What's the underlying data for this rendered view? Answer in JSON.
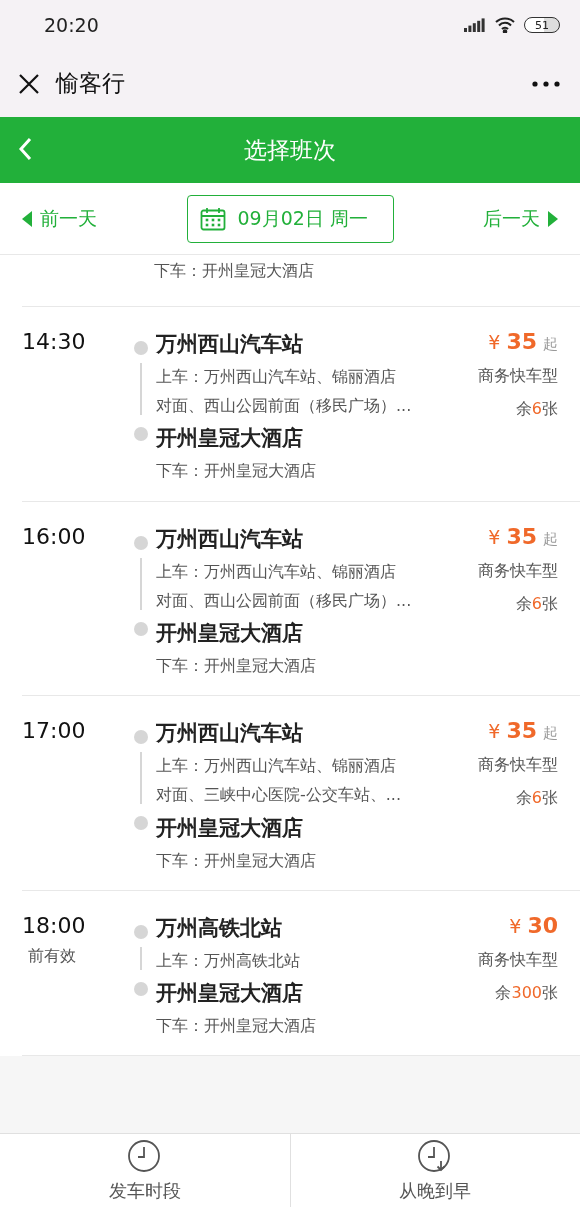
{
  "status_bar": {
    "time": "20:20",
    "battery": "51"
  },
  "app_bar": {
    "title": "愉客行"
  },
  "header": {
    "title": "选择班次"
  },
  "date_bar": {
    "prev": "前一天",
    "date": "09月02日 周一",
    "next": "后一天"
  },
  "partial_trip": {
    "dropoff": "下车：开州皇冠大酒店"
  },
  "trips": [
    {
      "time": "14:30",
      "from": "万州西山汽车站",
      "pickup_lines": [
        "上车：万州西山汽车站、锦丽酒店",
        "对面、西山公园前面（移民广场）..."
      ],
      "to": "开州皇冠大酒店",
      "dropoff": "下车：开州皇冠大酒店",
      "currency": "¥",
      "price": "35",
      "price_suffix": "起",
      "vehicle": "商务快车型",
      "seats": {
        "prefix": "余",
        "count": "6",
        "suffix": "张"
      }
    },
    {
      "time": "16:00",
      "from": "万州西山汽车站",
      "pickup_lines": [
        "上车：万州西山汽车站、锦丽酒店",
        "对面、西山公园前面（移民广场）..."
      ],
      "to": "开州皇冠大酒店",
      "dropoff": "下车：开州皇冠大酒店",
      "currency": "¥",
      "price": "35",
      "price_suffix": "起",
      "vehicle": "商务快车型",
      "seats": {
        "prefix": "余",
        "count": "6",
        "suffix": "张"
      }
    },
    {
      "time": "17:00",
      "from": "万州西山汽车站",
      "pickup_lines": [
        "上车：万州西山汽车站、锦丽酒店",
        "对面、三峡中心医院-公交车站、..."
      ],
      "to": "开州皇冠大酒店",
      "dropoff": "下车：开州皇冠大酒店",
      "currency": "¥",
      "price": "35",
      "price_suffix": "起",
      "vehicle": "商务快车型",
      "seats": {
        "prefix": "余",
        "count": "6",
        "suffix": "张"
      }
    },
    {
      "time": "18:00",
      "time_note": "前有效",
      "from": "万州高铁北站",
      "pickup_lines": [
        "上车：万州高铁北站"
      ],
      "to": "开州皇冠大酒店",
      "dropoff": "下车：开州皇冠大酒店",
      "currency": "¥",
      "price": "30",
      "vehicle": "商务快车型",
      "seats": {
        "prefix": "余",
        "count": "300",
        "suffix": "张"
      }
    }
  ],
  "bottom_bar": [
    {
      "kind": "clock",
      "label": "发车时段"
    },
    {
      "kind": "sort",
      "label": "从晚到早"
    }
  ]
}
